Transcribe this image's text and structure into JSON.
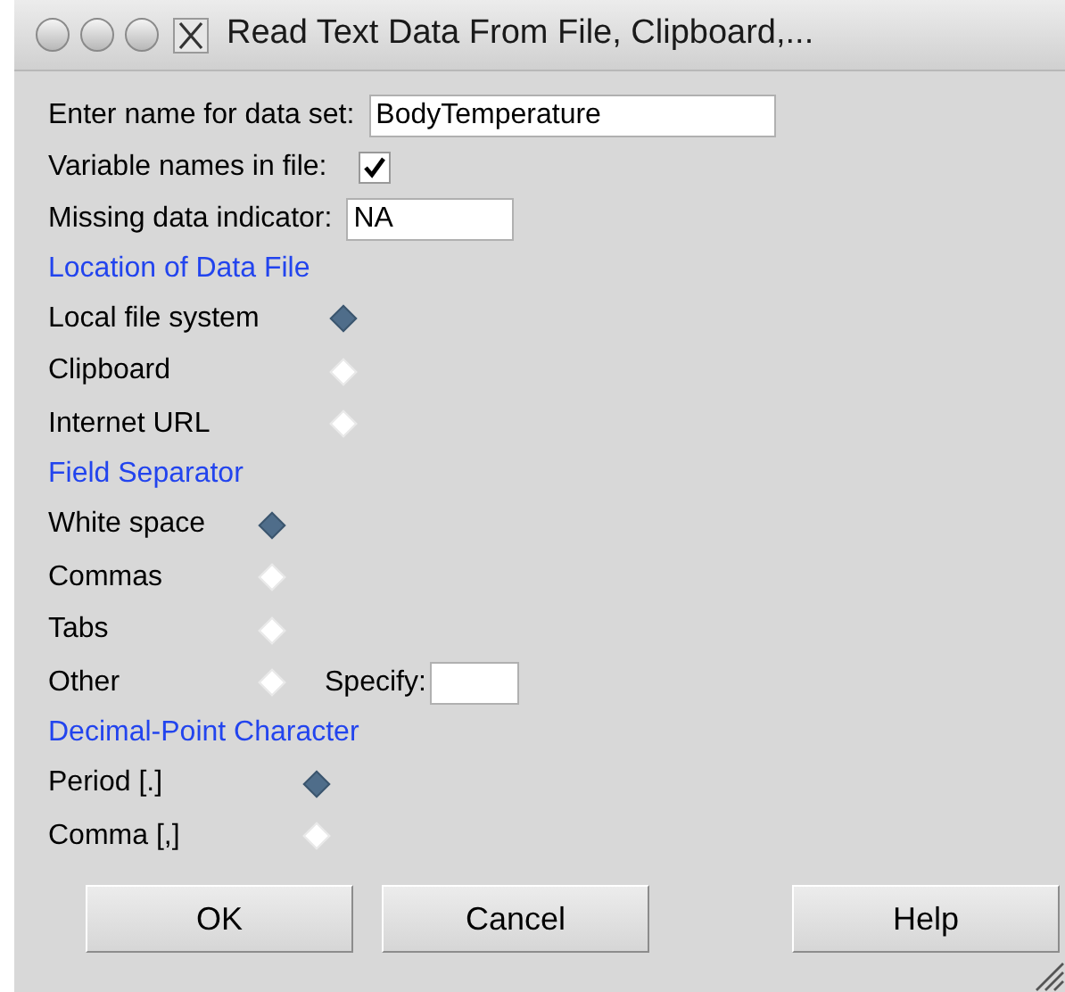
{
  "window": {
    "title": "Read Text Data From File, Clipboard,..."
  },
  "fields": [
    {
      "kind": "text",
      "label": "Enter name for data set:",
      "value": "BodyTemperature"
    },
    {
      "kind": "checkbox",
      "label": "Variable names in file:",
      "checked": true
    },
    {
      "kind": "text",
      "label": "Missing data indicator:",
      "value": "NA"
    }
  ],
  "sections": [
    {
      "title": "Location of Data File",
      "options": [
        {
          "label": "Local file system",
          "selected": true
        },
        {
          "label": "Clipboard",
          "selected": false
        },
        {
          "label": "Internet URL",
          "selected": false
        }
      ]
    },
    {
      "title": "Field Separator",
      "options": [
        {
          "label": "White space",
          "selected": true
        },
        {
          "label": "Commas",
          "selected": false
        },
        {
          "label": "Tabs",
          "selected": false
        },
        {
          "label": "Other",
          "selected": false,
          "specify": {
            "label": "Specify:"
          }
        }
      ]
    },
    {
      "title": "Decimal-Point Character",
      "options": [
        {
          "label": "Period [.]",
          "selected": true
        },
        {
          "label": "Comma [,]",
          "selected": false
        }
      ]
    }
  ],
  "buttons": [
    "OK",
    "Cancel",
    "Help"
  ]
}
